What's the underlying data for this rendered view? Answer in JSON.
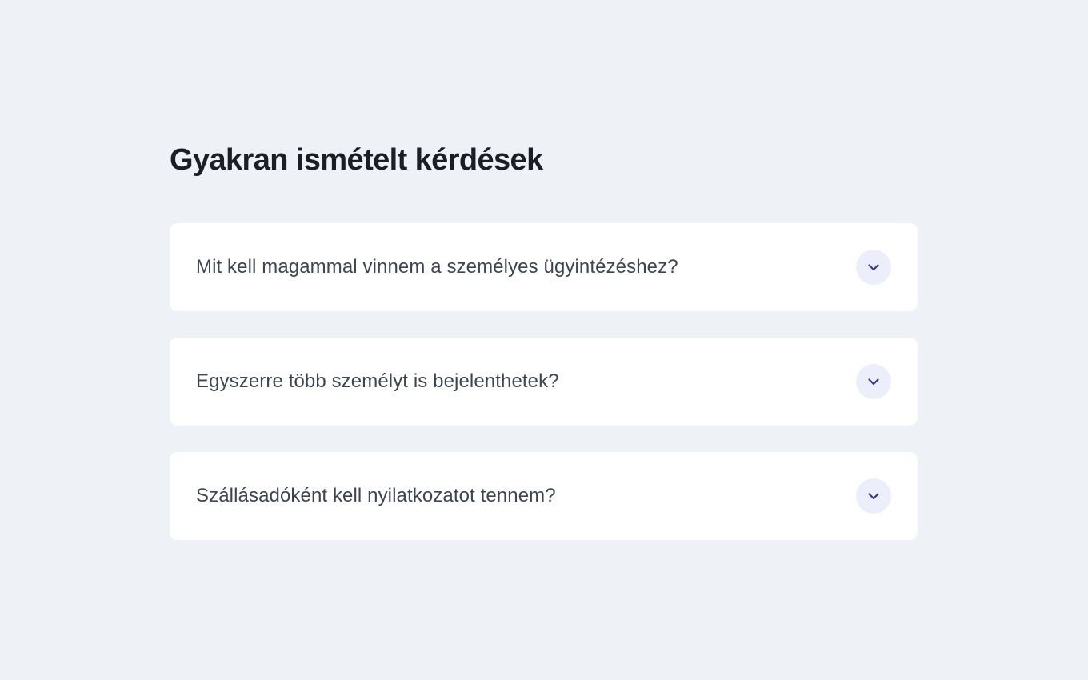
{
  "faq": {
    "title": "Gyakran ismételt kérdések",
    "items": [
      {
        "question": "Mit kell magammal vinnem a személyes ügyintézéshez?",
        "icon": "chevron-down-icon"
      },
      {
        "question": "Egyszerre több személyt is bejelenthetek?",
        "icon": "chevron-down-icon"
      },
      {
        "question": "Szállásadóként kell nyilatkozatot tennem?",
        "icon": "chevron-down-icon"
      }
    ]
  },
  "colors": {
    "page_background": "#eef1f6",
    "card_background": "#ffffff",
    "accent": "#3a3a8c",
    "toggle_background": "#eceffb"
  }
}
